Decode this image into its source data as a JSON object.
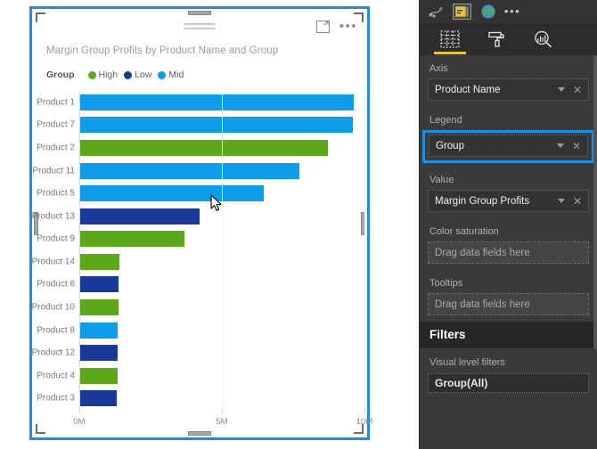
{
  "visual": {
    "title": "Margin Group Profits by Product Name and Group",
    "focus_icon": "focus-mode-icon",
    "more_icon": "more-options-icon",
    "grip_icon": "drag-grip-icon"
  },
  "legend": {
    "title": "Group",
    "items": [
      {
        "label": "High",
        "color": "#5CA818"
      },
      {
        "label": "Low",
        "color": "#1A3A99"
      },
      {
        "label": "Mid",
        "color": "#0E9BE8"
      }
    ]
  },
  "chart_data": {
    "type": "bar",
    "orientation": "horizontal",
    "title": "Margin Group Profits by Product Name and Group",
    "xlabel": "",
    "ylabel": "",
    "xlim": [
      0,
      10000000
    ],
    "xticks": [
      0,
      5000000,
      10000000
    ],
    "xticklabels": [
      "0M",
      "5M",
      "10M"
    ],
    "grid": true,
    "legend_position": "top-left",
    "legend_title": "Group",
    "categories": [
      "Product 1",
      "Product 7",
      "Product 2",
      "Product 11",
      "Product 5",
      "Product 13",
      "Product 9",
      "Product 14",
      "Product 6",
      "Product 10",
      "Product 8",
      "Product 12",
      "Product 4",
      "Product 3"
    ],
    "groups": [
      "Mid",
      "Mid",
      "High",
      "Mid",
      "Mid",
      "Low",
      "High",
      "High",
      "Low",
      "High",
      "Mid",
      "Low",
      "High",
      "Low"
    ],
    "values": [
      9.6,
      9.55,
      8.7,
      7.7,
      6.45,
      4.2,
      3.65,
      1.37,
      1.35,
      1.33,
      1.32,
      1.31,
      1.3,
      1.28
    ],
    "value_unit": "M",
    "colors": {
      "High": "#5CA818",
      "Low": "#1A3A99",
      "Mid": "#0E9BE8"
    }
  },
  "pane": {
    "gallery": [
      {
        "name": "scatter-chart-icon",
        "selected": false
      },
      {
        "name": "card-visual-icon",
        "selected": true
      },
      {
        "name": "map-visual-icon",
        "selected": false
      }
    ],
    "gallery_more": "•••",
    "tabs": [
      {
        "name": "fields-tab",
        "icon": "fields-grid-icon",
        "active": true
      },
      {
        "name": "format-tab",
        "icon": "paint-roller-icon",
        "active": false
      },
      {
        "name": "analytics-tab",
        "icon": "analytics-magnifier-icon",
        "active": false
      }
    ],
    "wells": [
      {
        "label": "Axis",
        "value": "Product Name",
        "empty": false,
        "highlight": false
      },
      {
        "label": "Legend",
        "value": "Group",
        "empty": false,
        "highlight": true
      },
      {
        "label": "Value",
        "value": "Margin Group Profits",
        "empty": false,
        "highlight": false
      },
      {
        "label": "Color saturation",
        "value": "Drag data fields here",
        "empty": true,
        "highlight": false
      },
      {
        "label": "Tooltips",
        "value": "Drag data fields here",
        "empty": true,
        "highlight": false
      }
    ],
    "filters": {
      "heading": "Filters",
      "subheading": "Visual level filters",
      "items": [
        "Group(All)"
      ]
    }
  }
}
